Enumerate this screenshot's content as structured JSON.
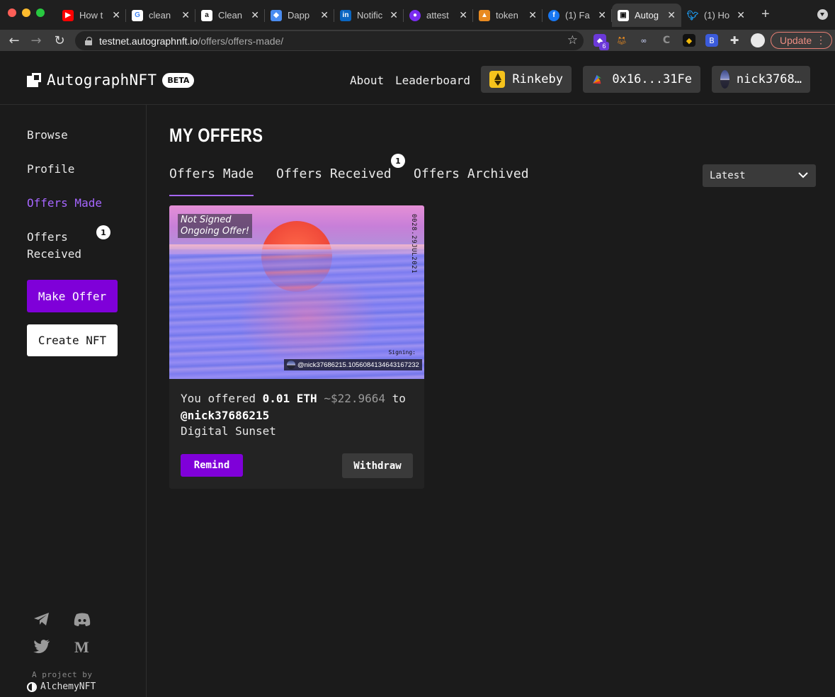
{
  "browser": {
    "tabs": [
      {
        "title": "How t",
        "favicon": "youtube-icon",
        "color": "#ff0000"
      },
      {
        "title": "clean",
        "favicon": "google-icon",
        "color": "#ffffff"
      },
      {
        "title": "Clean",
        "favicon": "amazon-icon",
        "color": "#ffffff"
      },
      {
        "title": "Dapp",
        "favicon": "dapp-icon",
        "color": "#4a8cf0"
      },
      {
        "title": "Notific",
        "favicon": "linkedin-icon",
        "color": "#0a66c2"
      },
      {
        "title": "attest",
        "favicon": "attest-icon",
        "color": "#7a2cf0"
      },
      {
        "title": "token",
        "favicon": "token-icon",
        "color": "#e88a20"
      },
      {
        "title": "(1) Fa",
        "favicon": "facebook-icon",
        "color": "#1877f2"
      },
      {
        "title": "Autog",
        "favicon": "autograph-icon",
        "color": "#ffffff",
        "active": true
      },
      {
        "title": "(1) Ho",
        "favicon": "twitter-icon",
        "color": "#1d9bf0"
      }
    ],
    "url_host": "testnet.autographnft.io",
    "url_path": "/offers/offers-made/",
    "ext_badge": "6",
    "update_label": "Update"
  },
  "header": {
    "logo_text": "AutographNFT",
    "beta_label": "BETA",
    "nav": [
      "About",
      "Leaderboard"
    ],
    "network_label": "Rinkeby",
    "wallet_label": "0x16...31Fe",
    "user_label": "nick3768…"
  },
  "sidebar": {
    "items": [
      {
        "label": "Browse"
      },
      {
        "label": "Profile"
      },
      {
        "label": "Offers Made",
        "active": true
      },
      {
        "label": "Offers\nReceived",
        "badge": "1"
      }
    ],
    "make_offer_label": "Make Offer",
    "create_nft_label": "Create NFT",
    "socials": [
      "telegram-icon",
      "discord-icon",
      "twitter-icon",
      "medium-icon"
    ],
    "project_by": "A project by",
    "alchemy_label": "AlchemyNFT"
  },
  "main": {
    "title": "MY OFFERS",
    "tabs": [
      {
        "label": "Offers Made",
        "active": true
      },
      {
        "label": "Offers Received",
        "badge": "1"
      },
      {
        "label": "Offers Archived"
      }
    ],
    "sort_value": "Latest"
  },
  "offer": {
    "status_line1": "Not Signed",
    "status_line2": "Ongoing Offer!",
    "date_stamp": "0028.29JUL2021",
    "signing_label": "Signing:",
    "signer_handle": "@nick37686215.1056084134643167232",
    "prefix": "You offered",
    "amount": "0.01 ETH",
    "usd": "~$22.9664",
    "to": "to",
    "recipient": "@nick37686215",
    "nft_name": "Digital Sunset",
    "remind_label": "Remind",
    "withdraw_label": "Withdraw"
  },
  "colors": {
    "accent": "#7f00d9",
    "active_text": "#a666ff",
    "background": "#1b1b1b"
  }
}
